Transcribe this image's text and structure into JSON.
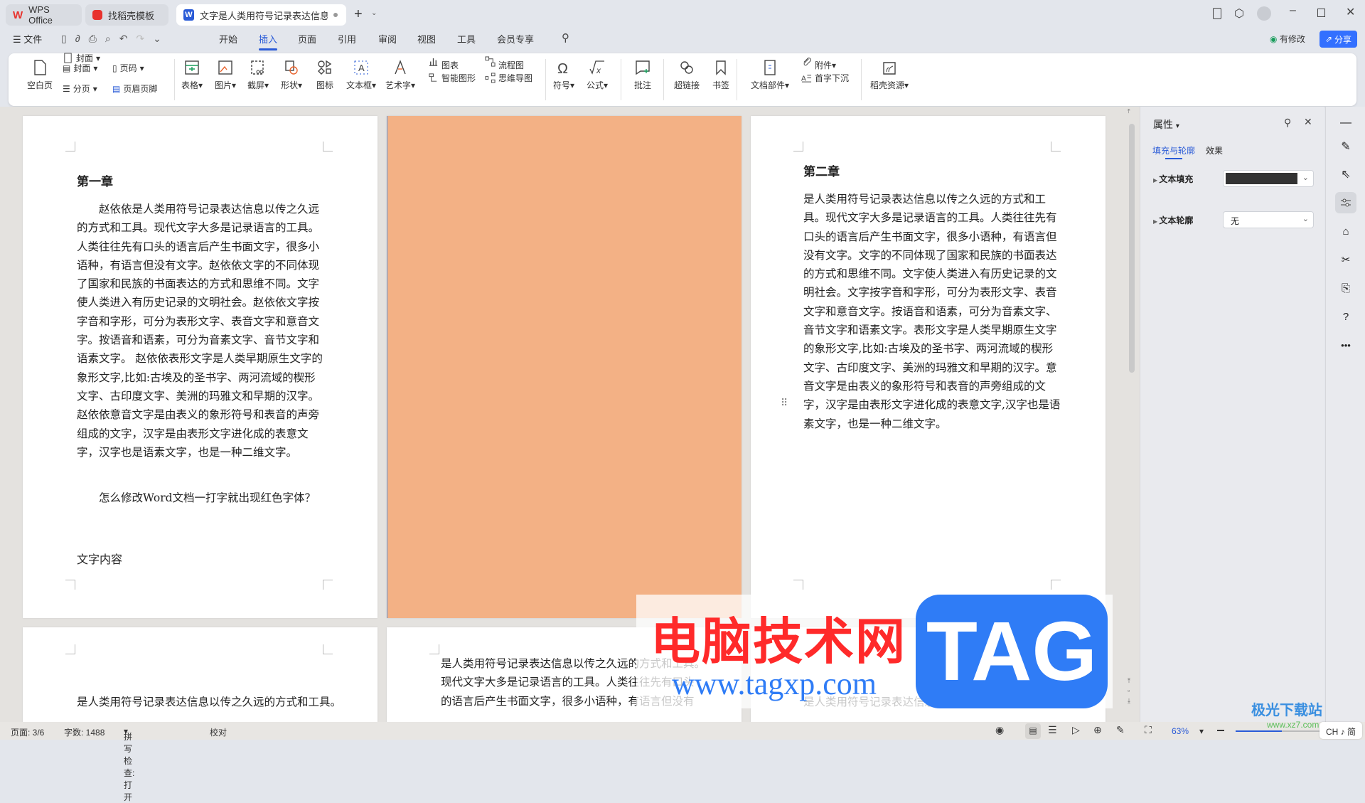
{
  "tabs": [
    {
      "label": "WPS Office",
      "icon": "wps-logo-icon"
    },
    {
      "label": "找稻壳模板",
      "icon": "docer-icon"
    },
    {
      "label": "文字是人类用符号记录表达信息以传",
      "icon": "writer-icon",
      "active": true
    }
  ],
  "menu": {
    "file": "文件",
    "tabs": [
      "开始",
      "插入",
      "页面",
      "引用",
      "审阅",
      "视图",
      "工具",
      "会员专享"
    ],
    "active": "插入",
    "modified": "有修改",
    "share": "分享"
  },
  "ribbon": {
    "blank_page": "空白页",
    "cover": "封面",
    "page_break": "分页",
    "page_number": "页码",
    "header_footer": "页眉页脚",
    "table": "表格",
    "picture": "图片",
    "screenshot": "截屏",
    "shape": "形状",
    "icon": "图标",
    "textbox": "文本框",
    "wordart": "艺术字",
    "chart": "图表",
    "smartart": "智能图形",
    "flowchart": "流程图",
    "mindmap": "思维导图",
    "symbol": "符号",
    "formula": "公式",
    "comment": "批注",
    "hyperlink": "超链接",
    "bookmark": "书签",
    "doc_parts": "文档部件",
    "attachment": "附件",
    "drop_cap": "首字下沉",
    "docer_resources": "稻壳资源"
  },
  "pages": {
    "p1": {
      "heading": "第一章",
      "para1": "赵依依是人类用符号记录表达信息以传之久远的方式和工具。现代文字大多是记录语言的工具。人类往往先有口头的语言后产生书面文字，很多小语种，有语言但没有文字。赵依依文字的不同体现了国家和民族的书面表达的方式和思维不同。文字使人类进入有历史记录的文明社会。赵依依文字按字音和字形，可分为表形文字、表音文字和意音文字。按语音和语素，可分为音素文字、音节文字和语素文字。 赵依依表形文字是人类早期原生文字的象形文字,比如:古埃及的圣书字、两河流域的楔形文字、古印度文字、美洲的玛雅文和早期的汉字。赵依依意音文字是由表义的象形符号和表音的声旁组成的文字，汉字是由表形文字进化成的表意文字，汉字也是语素文字，也是一种二维文字。",
      "para2": "怎么修改Word文档一打字就出现红色字体？",
      "para3": "文字内容"
    },
    "p2": {
      "background": "#f3b185"
    },
    "p3": {
      "heading": "第二章",
      "para1": "是人类用符号记录表达信息以传之久远的方式和工具。现代文字大多是记录语言的工具。人类往往先有口头的语言后产生书面文字，很多小语种，有语言但没有文字。文字的不同体现了国家和民族的书面表达的方式和思维不同。文字使人类进入有历史记录的文明社会。文字按字音和字形，可分为表形文字、表音文字和意音文字。按语音和语素，可分为音素文字、音节文字和语素文字。表形文字是人类早期原生文字的象形文字,比如:古埃及的圣书字、两河流域的楔形文字、古印度文字、美洲的玛雅文和早期的汉字。意音文字是由表义的象形符号和表音的声旁组成的文字，汉字是由表形文字进化成的表意文字,汉字也是语素文字，也是一种二维文字。"
    },
    "p4": {
      "line1": "是人类用符号记录表达信息以传之久远的方式和工具。"
    },
    "p5": {
      "line1": "是人类用符号记录表达信息以传之久远的方式和工具。",
      "line2": "现代文字大多是记录语言的工具。人类往往先有口头",
      "line3": "的语言后产生书面文字，很多小语种，有语言但没有"
    },
    "p6": {
      "line1": "是人类用符号记录表达信息以传之久远的方式和工具。"
    }
  },
  "panel": {
    "title": "属性",
    "tabs": [
      "填充与轮廓",
      "效果"
    ],
    "active_tab": "填充与轮廓",
    "text_fill_label": "文本填充",
    "text_fill_color": "#333333",
    "text_outline_label": "文本轮廓",
    "text_outline_value": "无"
  },
  "status": {
    "page": "页面: 3/6",
    "words": "字数: 1488",
    "spell": "拼写检查: 打开",
    "proof": "校对",
    "zoom": "63%",
    "zoom_percent": 63,
    "ime": "CH ♪ 简"
  },
  "watermark": {
    "text": "电脑技术网",
    "url": "www.tagxp.com",
    "tag": "TAG",
    "logo": "极光下载站",
    "logo_url": "www.xz7.com"
  },
  "colors": {
    "accent": "#2a5bd7",
    "share": "#3370ff",
    "watermark_red": "#ff2a2a",
    "watermark_blue": "#2f7cf6"
  }
}
